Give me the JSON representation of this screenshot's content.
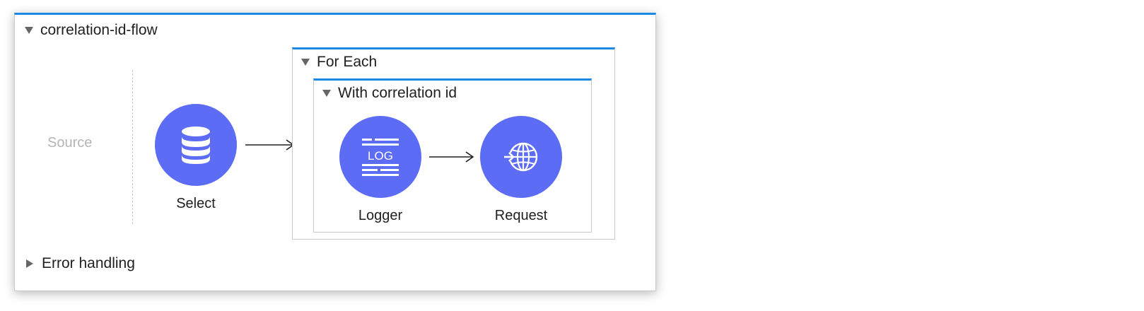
{
  "flow": {
    "name": "correlation-id-flow",
    "source_label": "Source",
    "error_handling_label": "Error handling"
  },
  "nodes": {
    "select": {
      "label": "Select",
      "icon": "database-icon"
    },
    "logger": {
      "label": "Logger",
      "icon": "log-icon",
      "icon_text": "LOG"
    },
    "request": {
      "label": "Request",
      "icon": "globe-icon"
    }
  },
  "scopes": {
    "for_each": {
      "label": "For Each"
    },
    "with_correlation_id": {
      "label": "With correlation id"
    }
  },
  "colors": {
    "accent_blue": "#1e88e5",
    "node_fill": "#5c6cf5"
  }
}
